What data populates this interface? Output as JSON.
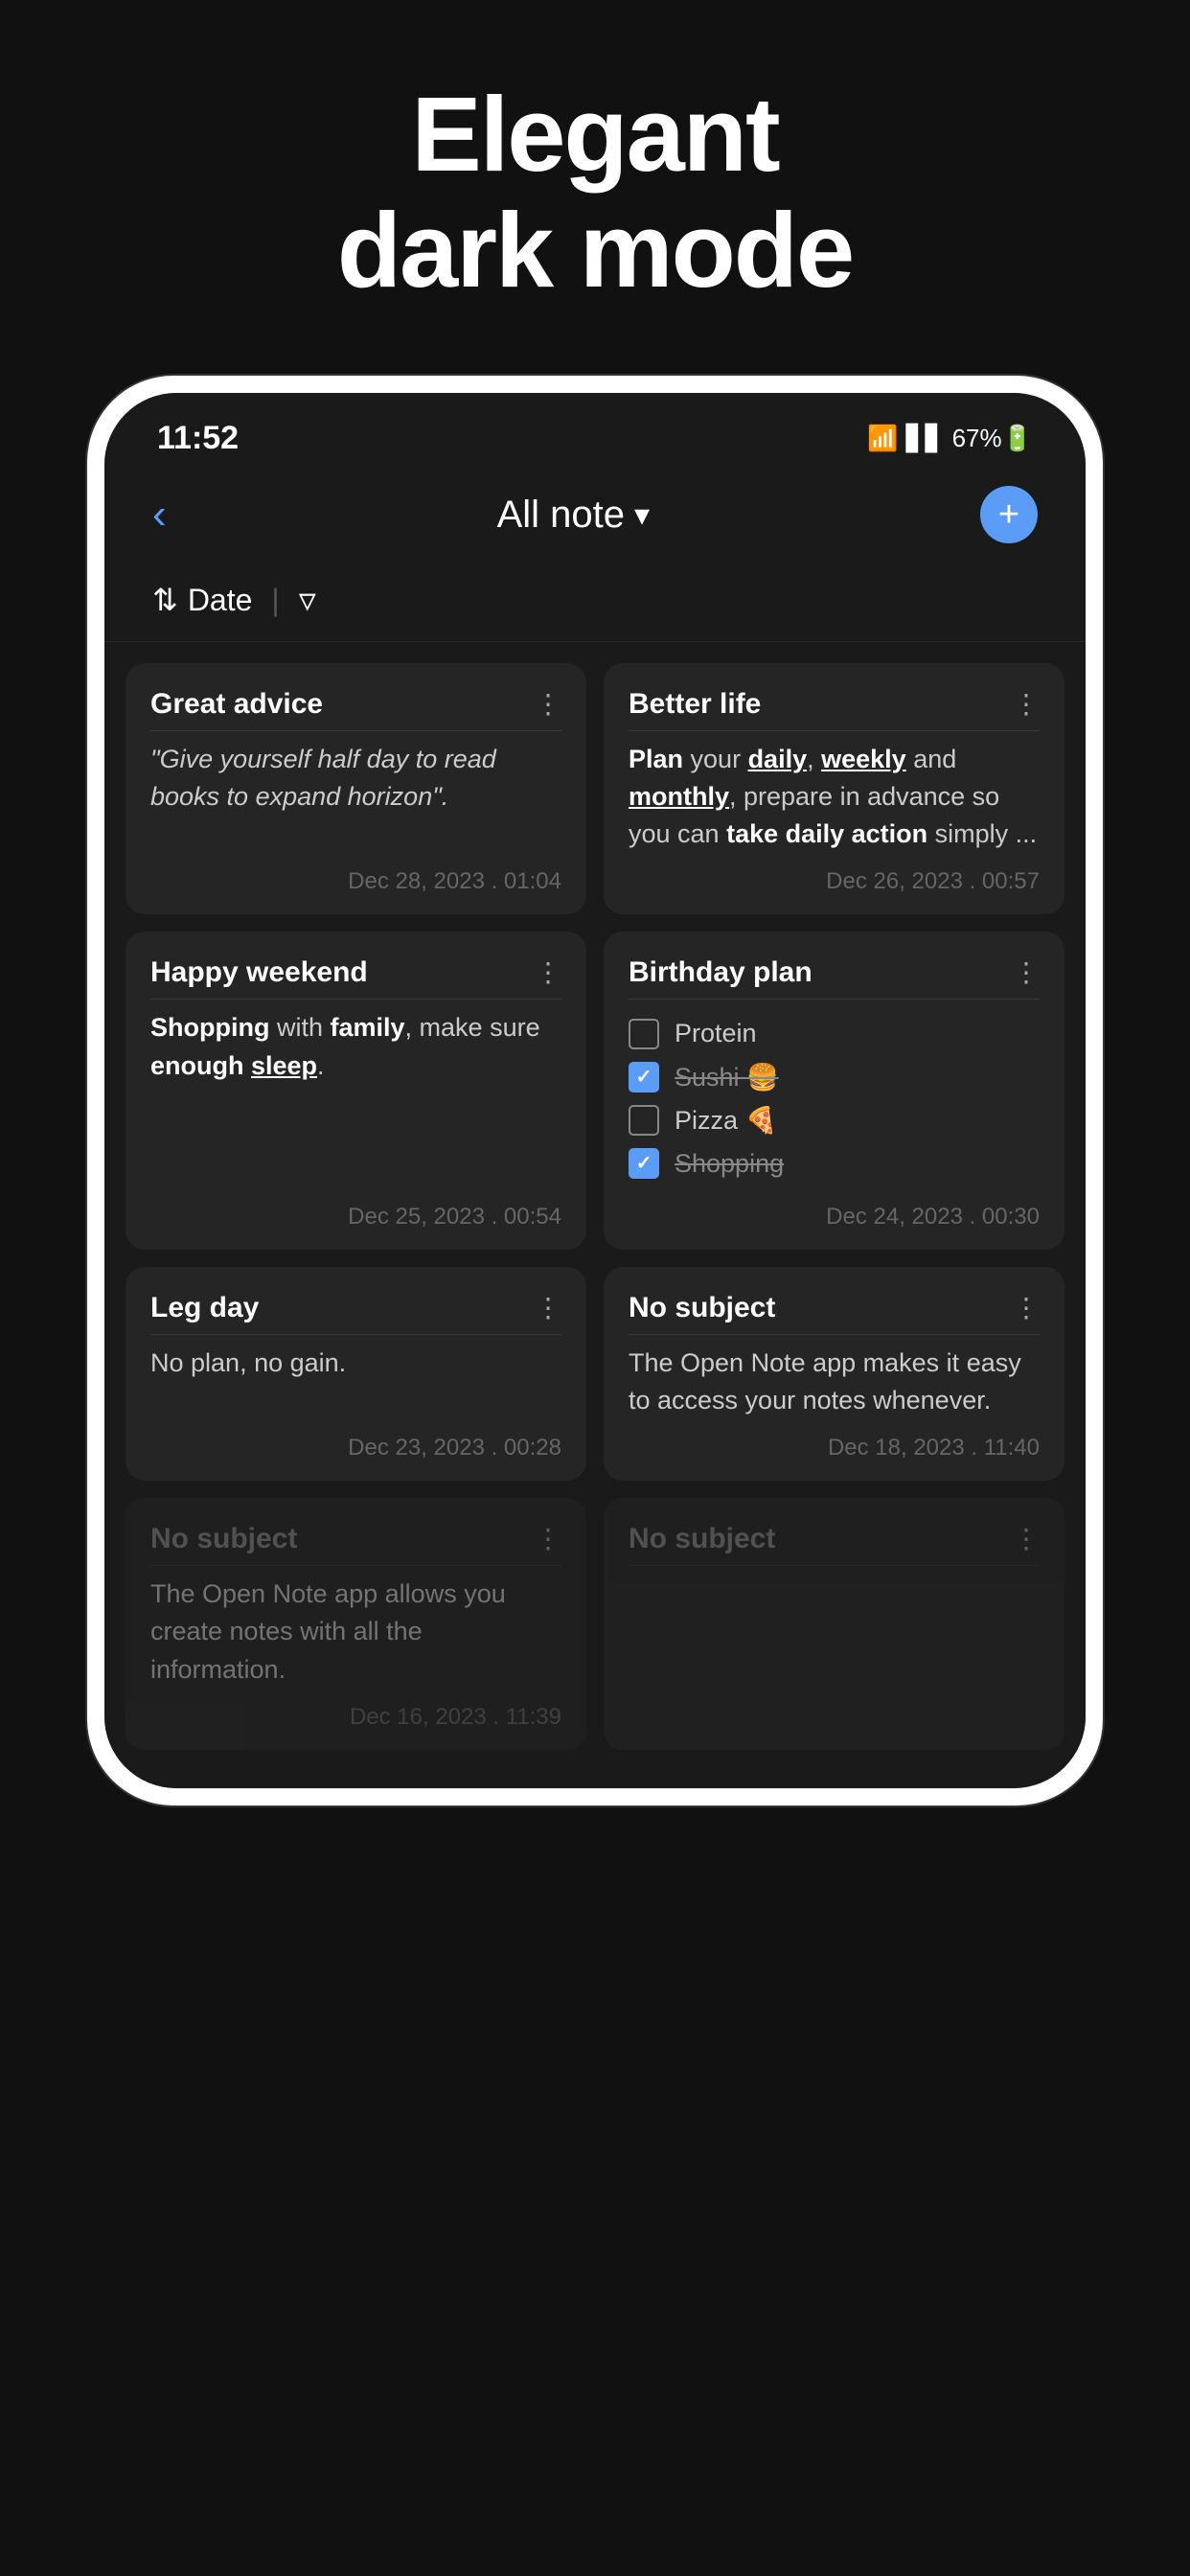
{
  "hero": {
    "title_line1": "Elegant",
    "title_line2": "dark mode"
  },
  "phone": {
    "statusBar": {
      "time": "11:52",
      "icons": "WiFi VoLTE signal 67%🔋"
    },
    "nav": {
      "back": "‹",
      "title": "All note",
      "chevron": "▾",
      "addBtn": "+"
    },
    "filterBar": {
      "sortIcon": "⇅",
      "dateLabel": "Date",
      "separator": "|",
      "filterIcon": "⋁"
    },
    "notes": [
      {
        "id": "great-advice",
        "title": "Great advice",
        "body_italic": "\"Give yourself half day to read books to expand horizon\".",
        "date": "Dec 28, 2023 . 01:04",
        "col": 0,
        "faded": false
      },
      {
        "id": "better-life",
        "title": "Better life",
        "body_html": true,
        "date": "Dec 26, 2023 . 00:57",
        "col": 1,
        "faded": false
      },
      {
        "id": "happy-weekend",
        "title": "Happy weekend",
        "body_html": true,
        "date": "Dec 25, 2023 . 00:54",
        "col": 0,
        "faded": false
      },
      {
        "id": "birthday-plan",
        "title": "Birthday plan",
        "checklist": [
          {
            "label": "Protein",
            "checked": false,
            "strike": false,
            "emoji": ""
          },
          {
            "label": "Sushi 🍔",
            "checked": true,
            "strike": true,
            "emoji": ""
          },
          {
            "label": "Pizza 🍕",
            "checked": false,
            "strike": false,
            "emoji": ""
          },
          {
            "label": "Shopping",
            "checked": true,
            "strike": true,
            "emoji": ""
          }
        ],
        "date": "Dec 24, 2023 . 00:30",
        "col": 1,
        "faded": false
      },
      {
        "id": "leg-day",
        "title": "Leg day",
        "body_plain": "No plan, no gain.",
        "date": "Dec 23, 2023 . 00:28",
        "col": 0,
        "faded": false
      },
      {
        "id": "no-subject-right",
        "title": "No subject",
        "body_plain": "The Open Note app makes it easy to access your notes whenever.",
        "date": "Dec 18, 2023 . 11:40",
        "col": 1,
        "faded": false
      },
      {
        "id": "no-subject-left",
        "title": "No subject",
        "body_plain": "The Open Note app allows you create notes with all the information.",
        "date": "Dec 16, 2023 . 11:39",
        "col": 0,
        "faded": true
      },
      {
        "id": "no-subject-bottom",
        "title": "No subject",
        "body_plain": "",
        "date": "",
        "col": 1,
        "faded": true
      }
    ]
  }
}
